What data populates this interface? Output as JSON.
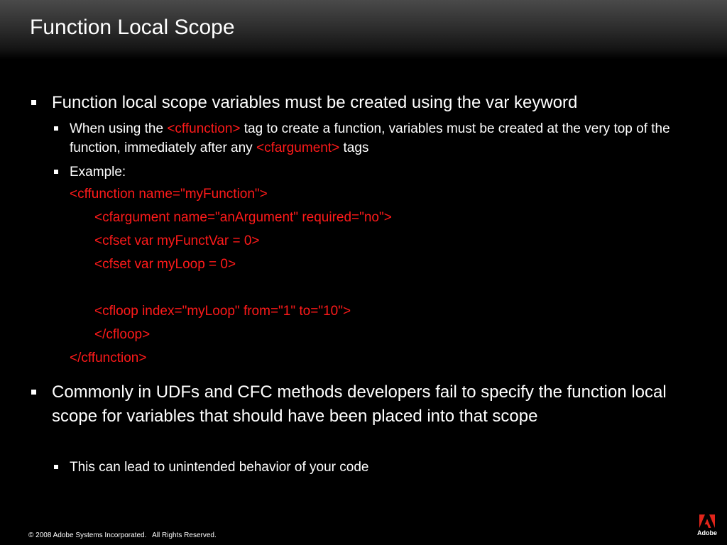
{
  "slide": {
    "title": "Function Local Scope"
  },
  "bullets": {
    "b1": "Function local scope variables must be created using the var keyword",
    "b1_sub1": {
      "part1": "When using the ",
      "tag1": "<cffunction>",
      "part2": " tag to create a function, variables must be created at the very top of the function, immediately after any ",
      "tag2": "<cfargument>",
      "part3": " tags"
    },
    "b1_sub2": "Example:",
    "b2": "Commonly in UDFs and CFC methods developers fail to specify the function local scope for variables that should have been placed into that scope",
    "b2_sub1": "This can lead to unintended behavior of your code"
  },
  "code": {
    "line1": "<cffunction name=\"myFunction\">",
    "line2": "<cfargument name=\"anArgument\" required=\"no\">",
    "line3": "<cfset var myFunctVar = 0>",
    "line4": "<cfset var myLoop = 0>",
    "line5": "<cfloop index=\"myLoop\" from=\"1\" to=\"10\">",
    "line6": "</cfloop>",
    "line7": "</cffunction>"
  },
  "footer": {
    "copyright": "© 2008 Adobe Systems Incorporated.   All Rights Reserved."
  },
  "logo": {
    "text": "Adobe",
    "icon": "adobe-logo-icon",
    "color": "#e1251b"
  }
}
